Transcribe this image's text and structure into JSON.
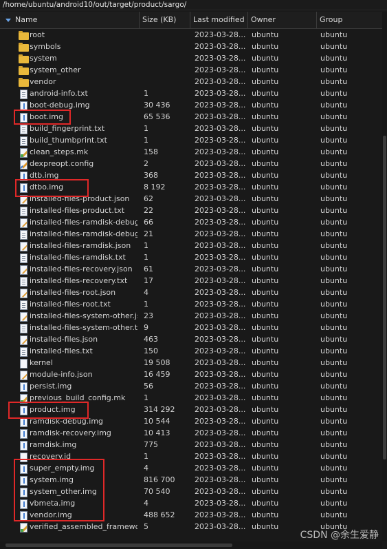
{
  "path": "/home/ubuntu/android10/out/target/product/sargo/",
  "columns": {
    "name": "Name",
    "size": "Size (KB)",
    "modified": "Last modified",
    "owner": "Owner",
    "group": "Group"
  },
  "files": [
    {
      "name": "root",
      "size": "",
      "modified": "2023-03-28...",
      "owner": "ubuntu",
      "group": "ubuntu",
      "icon": "folder-icon"
    },
    {
      "name": "symbols",
      "size": "",
      "modified": "2023-03-28...",
      "owner": "ubuntu",
      "group": "ubuntu",
      "icon": "folder-icon"
    },
    {
      "name": "system",
      "size": "",
      "modified": "2023-03-28...",
      "owner": "ubuntu",
      "group": "ubuntu",
      "icon": "folder-icon"
    },
    {
      "name": "system_other",
      "size": "",
      "modified": "2023-03-28...",
      "owner": "ubuntu",
      "group": "ubuntu",
      "icon": "folder-icon"
    },
    {
      "name": "vendor",
      "size": "",
      "modified": "2023-03-28...",
      "owner": "ubuntu",
      "group": "ubuntu",
      "icon": "folder-icon"
    },
    {
      "name": "android-info.txt",
      "size": "1",
      "modified": "2023-03-28...",
      "owner": "ubuntu",
      "group": "ubuntu",
      "icon": "text-file-icon"
    },
    {
      "name": "boot-debug.img",
      "size": "30 436",
      "modified": "2023-03-28...",
      "owner": "ubuntu",
      "group": "ubuntu",
      "icon": "image-file-icon"
    },
    {
      "name": "boot.img",
      "size": "65 536",
      "modified": "2023-03-28...",
      "owner": "ubuntu",
      "group": "ubuntu",
      "icon": "image-file-icon"
    },
    {
      "name": "build_fingerprint.txt",
      "size": "1",
      "modified": "2023-03-28...",
      "owner": "ubuntu",
      "group": "ubuntu",
      "icon": "text-file-icon"
    },
    {
      "name": "build_thumbprint.txt",
      "size": "1",
      "modified": "2023-03-28...",
      "owner": "ubuntu",
      "group": "ubuntu",
      "icon": "text-file-icon"
    },
    {
      "name": "clean_steps.mk",
      "size": "158",
      "modified": "2023-03-28...",
      "owner": "ubuntu",
      "group": "ubuntu",
      "icon": "makefile-icon"
    },
    {
      "name": "dexpreopt.config",
      "size": "2",
      "modified": "2023-03-28...",
      "owner": "ubuntu",
      "group": "ubuntu",
      "icon": "edit-file-icon"
    },
    {
      "name": "dtb.img",
      "size": "368",
      "modified": "2023-03-28...",
      "owner": "ubuntu",
      "group": "ubuntu",
      "icon": "image-file-icon"
    },
    {
      "name": "dtbo.img",
      "size": "8 192",
      "modified": "2023-03-28...",
      "owner": "ubuntu",
      "group": "ubuntu",
      "icon": "image-file-icon"
    },
    {
      "name": "installed-files-product.json",
      "size": "62",
      "modified": "2023-03-28...",
      "owner": "ubuntu",
      "group": "ubuntu",
      "icon": "json-file-icon"
    },
    {
      "name": "installed-files-product.txt",
      "size": "22",
      "modified": "2023-03-28...",
      "owner": "ubuntu",
      "group": "ubuntu",
      "icon": "text-file-icon"
    },
    {
      "name": "installed-files-ramdisk-debug.j...",
      "size": "66",
      "modified": "2023-03-28...",
      "owner": "ubuntu",
      "group": "ubuntu",
      "icon": "json-file-icon"
    },
    {
      "name": "installed-files-ramdisk-debug.txt",
      "size": "21",
      "modified": "2023-03-28...",
      "owner": "ubuntu",
      "group": "ubuntu",
      "icon": "text-file-icon"
    },
    {
      "name": "installed-files-ramdisk.json",
      "size": "1",
      "modified": "2023-03-28...",
      "owner": "ubuntu",
      "group": "ubuntu",
      "icon": "json-file-icon"
    },
    {
      "name": "installed-files-ramdisk.txt",
      "size": "1",
      "modified": "2023-03-28...",
      "owner": "ubuntu",
      "group": "ubuntu",
      "icon": "text-file-icon"
    },
    {
      "name": "installed-files-recovery.json",
      "size": "61",
      "modified": "2023-03-28...",
      "owner": "ubuntu",
      "group": "ubuntu",
      "icon": "json-file-icon"
    },
    {
      "name": "installed-files-recovery.txt",
      "size": "17",
      "modified": "2023-03-28...",
      "owner": "ubuntu",
      "group": "ubuntu",
      "icon": "text-file-icon"
    },
    {
      "name": "installed-files-root.json",
      "size": "4",
      "modified": "2023-03-28...",
      "owner": "ubuntu",
      "group": "ubuntu",
      "icon": "json-file-icon"
    },
    {
      "name": "installed-files-root.txt",
      "size": "1",
      "modified": "2023-03-28...",
      "owner": "ubuntu",
      "group": "ubuntu",
      "icon": "text-file-icon"
    },
    {
      "name": "installed-files-system-other.json",
      "size": "23",
      "modified": "2023-03-28...",
      "owner": "ubuntu",
      "group": "ubuntu",
      "icon": "json-file-icon"
    },
    {
      "name": "installed-files-system-other.txt",
      "size": "9",
      "modified": "2023-03-28...",
      "owner": "ubuntu",
      "group": "ubuntu",
      "icon": "text-file-icon"
    },
    {
      "name": "installed-files.json",
      "size": "463",
      "modified": "2023-03-28...",
      "owner": "ubuntu",
      "group": "ubuntu",
      "icon": "json-file-icon"
    },
    {
      "name": "installed-files.txt",
      "size": "150",
      "modified": "2023-03-28...",
      "owner": "ubuntu",
      "group": "ubuntu",
      "icon": "text-file-icon"
    },
    {
      "name": "kernel",
      "size": "19 508",
      "modified": "2023-03-28...",
      "owner": "ubuntu",
      "group": "ubuntu",
      "icon": "blank-file-icon"
    },
    {
      "name": "module-info.json",
      "size": "16 459",
      "modified": "2023-03-28...",
      "owner": "ubuntu",
      "group": "ubuntu",
      "icon": "json-file-icon"
    },
    {
      "name": "persist.img",
      "size": "56",
      "modified": "2023-03-28...",
      "owner": "ubuntu",
      "group": "ubuntu",
      "icon": "image-file-icon"
    },
    {
      "name": "previous_build_config.mk",
      "size": "1",
      "modified": "2023-03-28...",
      "owner": "ubuntu",
      "group": "ubuntu",
      "icon": "makefile-icon"
    },
    {
      "name": "product.img",
      "size": "314 292",
      "modified": "2023-03-28...",
      "owner": "ubuntu",
      "group": "ubuntu",
      "icon": "image-file-icon"
    },
    {
      "name": "ramdisk-debug.img",
      "size": "10 544",
      "modified": "2023-03-28...",
      "owner": "ubuntu",
      "group": "ubuntu",
      "icon": "image-file-icon"
    },
    {
      "name": "ramdisk-recovery.img",
      "size": "10 413",
      "modified": "2023-03-28...",
      "owner": "ubuntu",
      "group": "ubuntu",
      "icon": "image-file-icon"
    },
    {
      "name": "ramdisk.img",
      "size": "775",
      "modified": "2023-03-28...",
      "owner": "ubuntu",
      "group": "ubuntu",
      "icon": "image-file-icon"
    },
    {
      "name": "recovery.id",
      "size": "1",
      "modified": "2023-03-28...",
      "owner": "ubuntu",
      "group": "ubuntu",
      "icon": "blank-file-icon"
    },
    {
      "name": "super_empty.img",
      "size": "4",
      "modified": "2023-03-28...",
      "owner": "ubuntu",
      "group": "ubuntu",
      "icon": "image-file-icon"
    },
    {
      "name": "system.img",
      "size": "816 700",
      "modified": "2023-03-28...",
      "owner": "ubuntu",
      "group": "ubuntu",
      "icon": "image-file-icon"
    },
    {
      "name": "system_other.img",
      "size": "70 540",
      "modified": "2023-03-28...",
      "owner": "ubuntu",
      "group": "ubuntu",
      "icon": "image-file-icon"
    },
    {
      "name": "vbmeta.img",
      "size": "4",
      "modified": "2023-03-28...",
      "owner": "ubuntu",
      "group": "ubuntu",
      "icon": "image-file-icon"
    },
    {
      "name": "vendor.img",
      "size": "488 652",
      "modified": "2023-03-28...",
      "owner": "ubuntu",
      "group": "ubuntu",
      "icon": "image-file-icon"
    },
    {
      "name": "verified_assembled_framewo...",
      "size": "5",
      "modified": "2023-03-28...",
      "owner": "ubuntu",
      "group": "ubuntu",
      "icon": "makefile-icon"
    }
  ],
  "highlight_color": "#e02828",
  "watermark": "CSDN @余生爱静"
}
